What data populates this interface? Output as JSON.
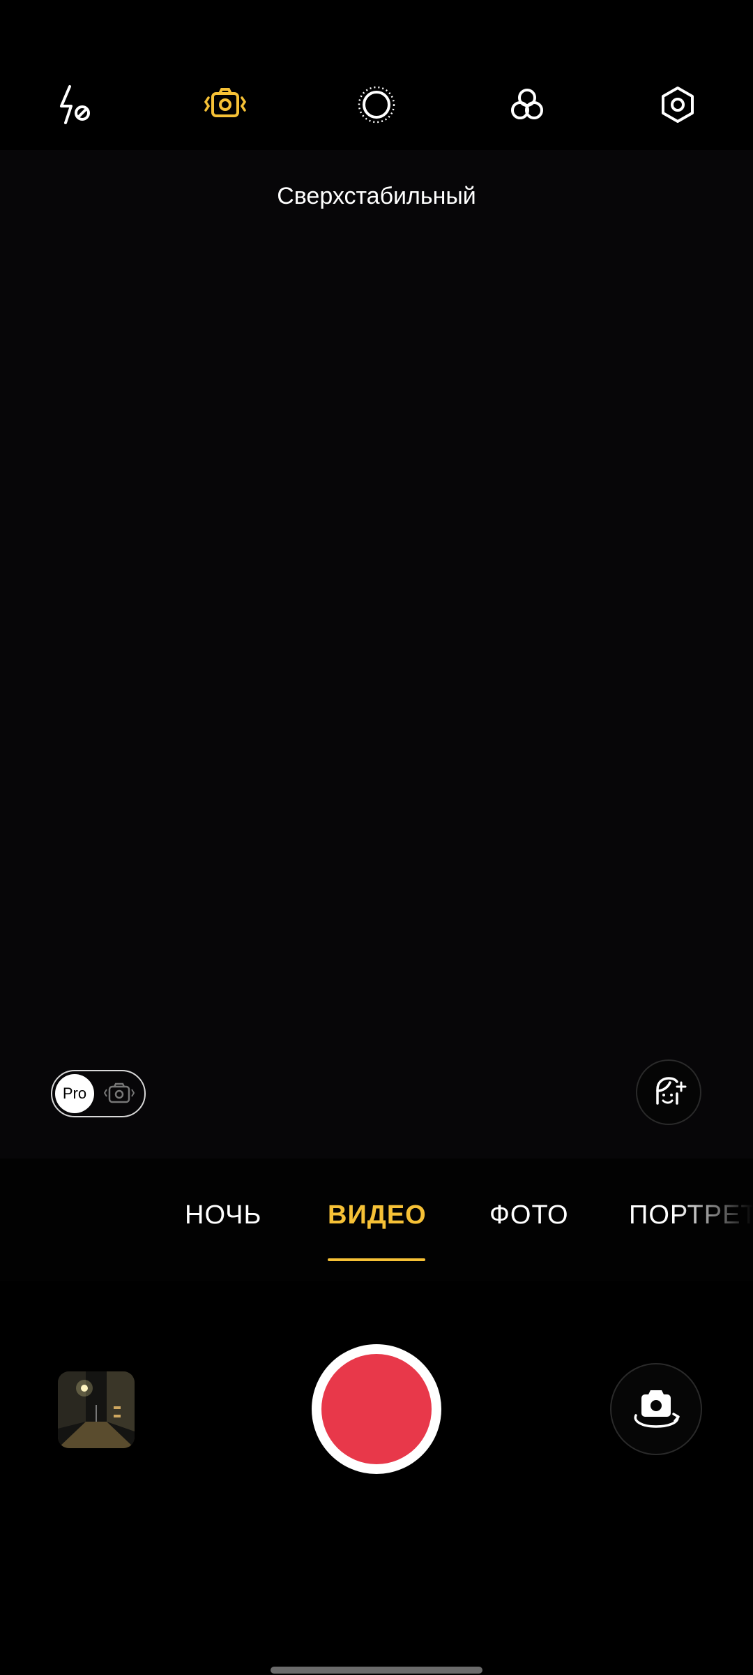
{
  "toolbar": {
    "icons": [
      "flash-off-icon",
      "stabilization-icon",
      "light-ring-icon",
      "filter-icon",
      "settings-icon"
    ],
    "active_color": "#f6c136"
  },
  "viewfinder": {
    "mode_hint": "Сверхстабильный"
  },
  "pro_toggle": {
    "label": "Pro"
  },
  "modes": {
    "items": [
      "НОЧЬ",
      "ВИДЕО",
      "ФОТО",
      "ПОРТРЕТ"
    ],
    "selected": "ВИДЕО",
    "active_color": "#f6c136"
  },
  "controls": {
    "shutter_color": "#e8384a"
  }
}
